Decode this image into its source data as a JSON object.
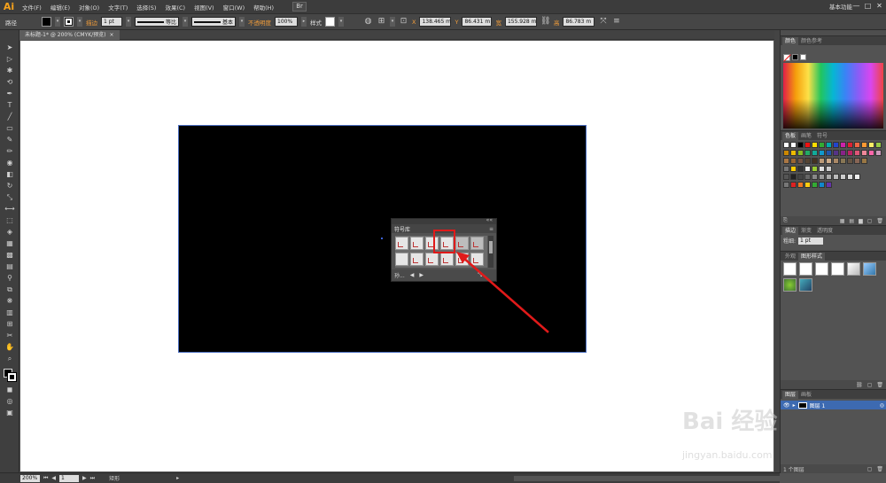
{
  "app": {
    "logo": "Ai",
    "workspace": "基本功能"
  },
  "menu": [
    "文件(F)",
    "编辑(E)",
    "对象(O)",
    "文字(T)",
    "选择(S)",
    "效果(C)",
    "视图(V)",
    "窗口(W)",
    "帮助(H)"
  ],
  "bridge_btn": "Br",
  "window_controls": {
    "minimize": "—",
    "restore": "□",
    "close": "✕"
  },
  "control": {
    "selection_label": "路径",
    "stroke_label": "描边",
    "stroke_weight": "1 pt",
    "profile": "等比",
    "brush": "基本",
    "opacity_label": "不透明度",
    "opacity_value": "100%",
    "style_label": "样式",
    "x": "138.465 m",
    "y": "86.431 m",
    "w": "155.928 m",
    "h": "86.783 m"
  },
  "document_tab": {
    "title": "未标题-1* @ 200% (CMYK/预览)",
    "close": "×"
  },
  "symbols_panel": {
    "title": "符号库",
    "menu": "≡",
    "collapse": "««",
    "footer_label": "孙..."
  },
  "right_panels": {
    "color_tabs": [
      "颜色",
      "颜色参考"
    ],
    "swatch_tabs": [
      "色板",
      "画笔",
      "符号"
    ],
    "stroke_tabs": [
      "描边",
      "渐变",
      "透明度"
    ],
    "stroke_weight_label": "粗细:",
    "stroke_weight_value": "1 pt",
    "style_tabs": [
      "外观",
      "图形样式"
    ],
    "layers_tabs": [
      "图层",
      "画板"
    ],
    "layer_name": "图层 1",
    "layer_count": "1 个图层"
  },
  "status": {
    "zoom": "200%",
    "page": "1",
    "tool": "矩形"
  },
  "watermark": {
    "text": "Bai 经验",
    "url": "jingyan.baidu.com"
  },
  "colors": {
    "highlight": "#e01a1a",
    "arrow": "#e01a1a",
    "selection": "#3b62d9",
    "accent": "#f29d3a"
  }
}
